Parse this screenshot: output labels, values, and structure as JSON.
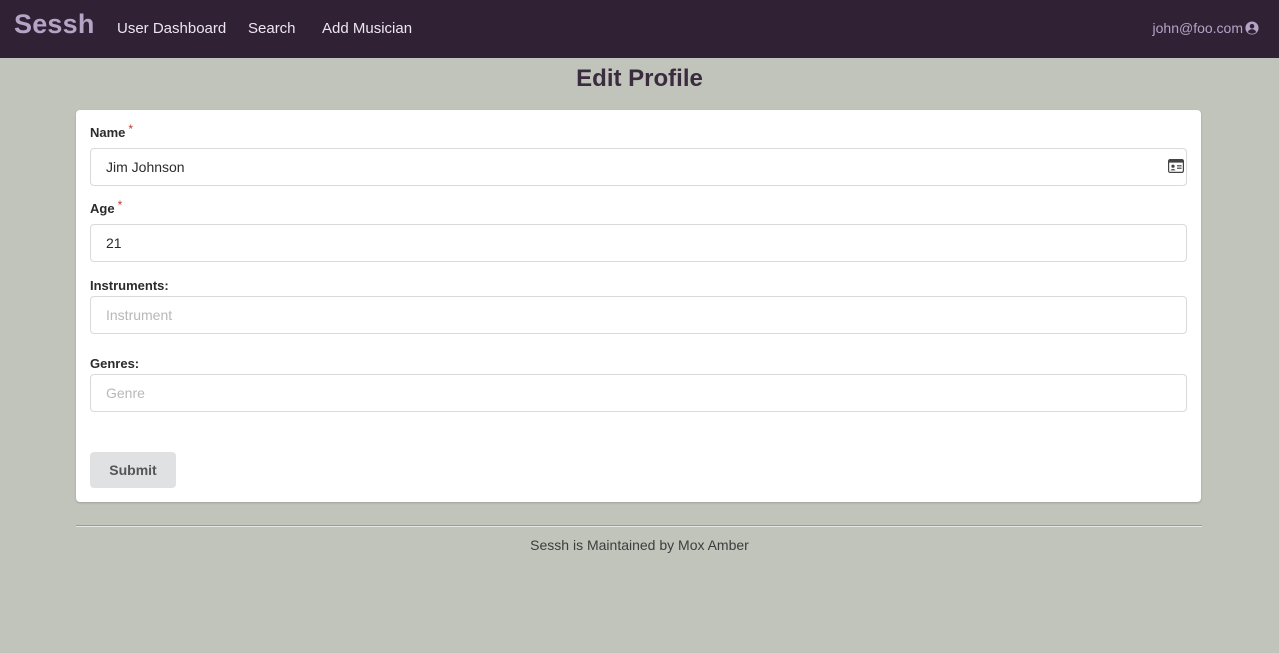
{
  "nav": {
    "brand": "Sessh",
    "items": [
      "User Dashboard",
      "Search",
      "Add Musician"
    ],
    "user_email": "john@foo.com",
    "user_icon": "user-circle-icon"
  },
  "page": {
    "title": "Edit Profile"
  },
  "form": {
    "name": {
      "label": "Name",
      "required_mark": "*",
      "value": "Jim Johnson",
      "icon": "id-card-icon"
    },
    "age": {
      "label": "Age",
      "required_mark": "*",
      "value": "21"
    },
    "instruments": {
      "label": "Instruments:",
      "placeholder": "Instrument"
    },
    "genres": {
      "label": "Genres:",
      "placeholder": "Genre"
    },
    "submit_label": "Submit"
  },
  "footer": {
    "text": "Sessh is Maintained by Mox Amber"
  },
  "colors": {
    "navbar": "#302135",
    "brand": "#b4a4c6",
    "background": "#c0c4bb",
    "required": "#c0392b"
  }
}
